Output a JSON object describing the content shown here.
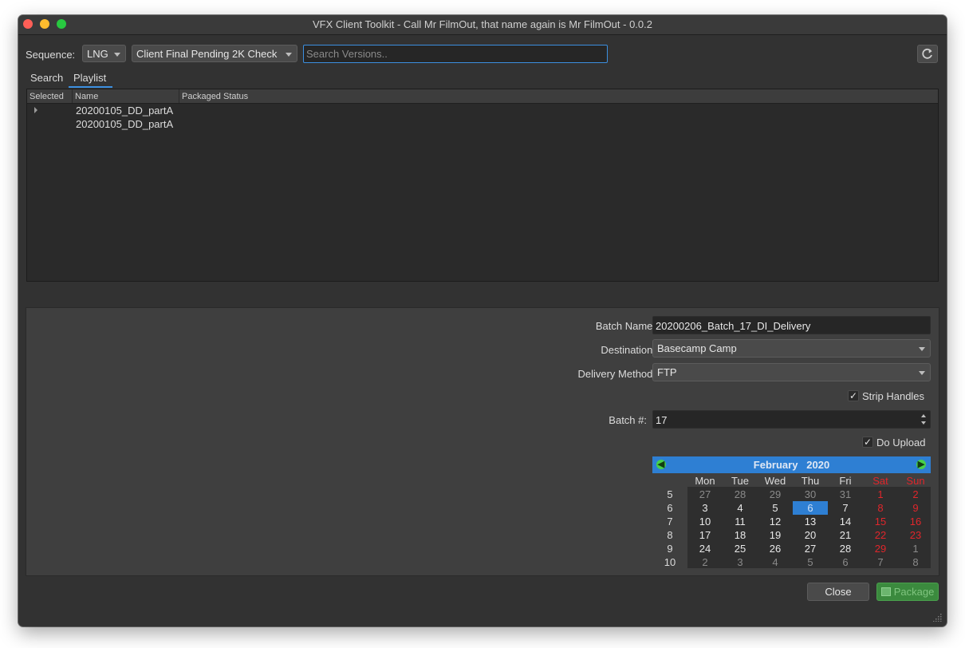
{
  "window": {
    "title": "VFX Client Toolkit - Call Mr FilmOut, that name again is Mr FilmOut - 0.0.2"
  },
  "toolbar": {
    "sequence_label": "Sequence:",
    "sequence_value": "LNG",
    "filter_value": "Client Final Pending 2K Check",
    "search_placeholder": "Search Versions..",
    "search_value": ""
  },
  "tabs": [
    {
      "label": "Search",
      "active": false
    },
    {
      "label": "Playlist",
      "active": true
    }
  ],
  "table": {
    "columns": [
      "Selected",
      "Name",
      "Packaged Status"
    ],
    "rows": [
      {
        "name": "20200105_DD_partA",
        "expandable": true
      },
      {
        "name": "20200105_DD_partA",
        "expandable": false
      }
    ]
  },
  "form": {
    "batch_name_label": "Batch Name:",
    "batch_name_value": "20200206_Batch_17_DI_Delivery",
    "destination_label": "Destination:",
    "destination_value": "Basecamp Camp",
    "delivery_method_label": "Delivery Method:",
    "delivery_method_value": "FTP",
    "strip_handles_label": "Strip Handles",
    "strip_handles_checked": true,
    "batch_num_label": "Batch #:",
    "batch_num_value": "17",
    "do_upload_label": "Do Upload",
    "do_upload_checked": true
  },
  "calendar": {
    "month": "February",
    "year": "2020",
    "weekdays": [
      "Mon",
      "Tue",
      "Wed",
      "Thu",
      "Fri",
      "Sat",
      "Sun"
    ],
    "weeks": [
      "5",
      "6",
      "7",
      "8",
      "9",
      "10"
    ],
    "days": [
      [
        "27",
        "28",
        "29",
        "30",
        "31",
        "1",
        "2"
      ],
      [
        "3",
        "4",
        "5",
        "6",
        "7",
        "8",
        "9"
      ],
      [
        "10",
        "11",
        "12",
        "13",
        "14",
        "15",
        "16"
      ],
      [
        "17",
        "18",
        "19",
        "20",
        "21",
        "22",
        "23"
      ],
      [
        "24",
        "25",
        "26",
        "27",
        "28",
        "29",
        "1"
      ],
      [
        "2",
        "3",
        "4",
        "5",
        "6",
        "7",
        "8"
      ]
    ],
    "selected_day": "6",
    "weekend_color": "#e0262b",
    "header_color": "#2e7fd3"
  },
  "buttons": {
    "close_label": "Close",
    "package_label": "Package"
  },
  "colors": {
    "accent": "#3c8fe0",
    "package_green": "#3b8a3e"
  }
}
